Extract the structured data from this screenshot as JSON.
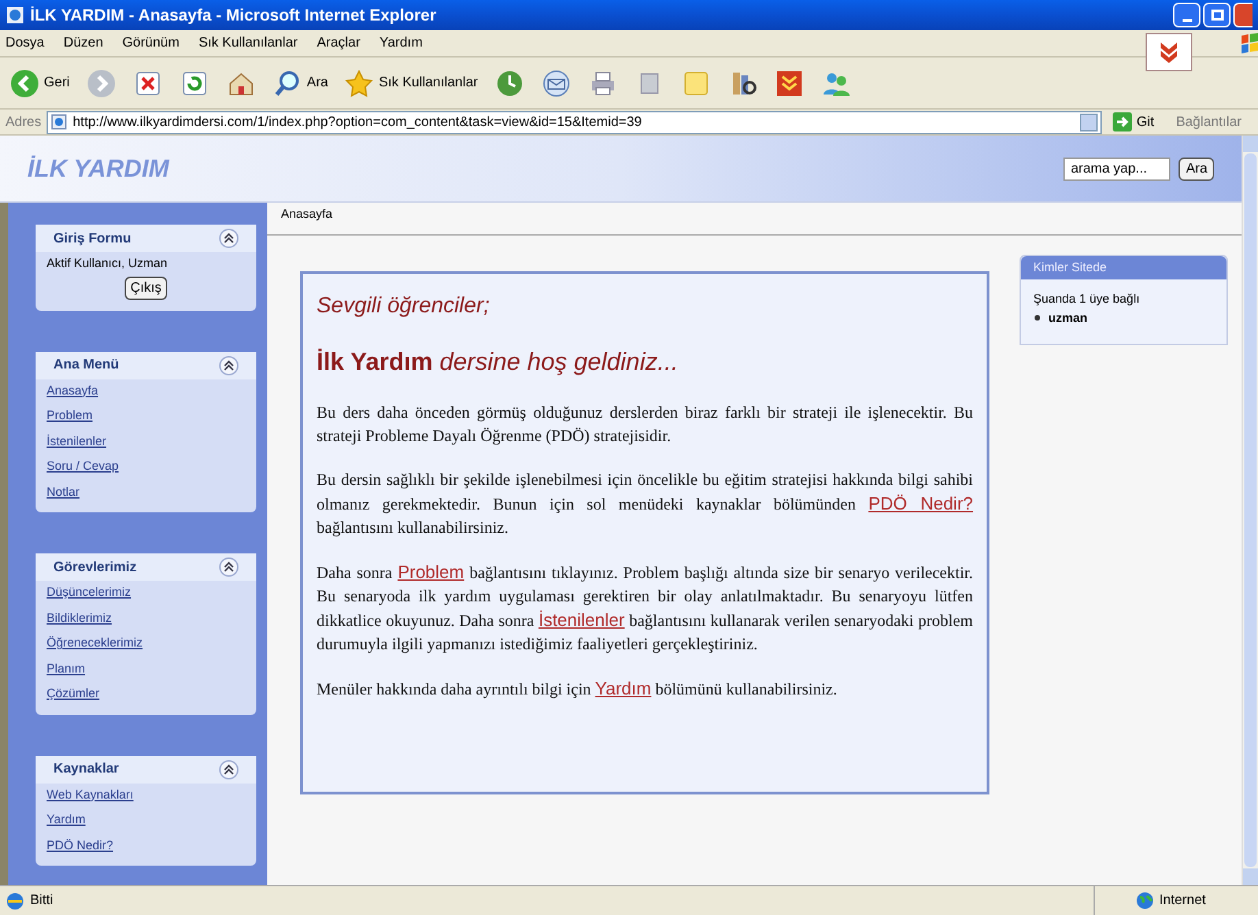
{
  "window": {
    "title": "İLK YARDIM - Anasayfa - Microsoft Internet Explorer"
  },
  "menu": [
    "Dosya",
    "Düzen",
    "Görünüm",
    "Sık Kullanılanlar",
    "Araçlar",
    "Yardım"
  ],
  "toolbar": [
    {
      "kind": "back",
      "label": "Geri"
    },
    {
      "kind": "forward"
    },
    {
      "kind": "stop"
    },
    {
      "kind": "refresh"
    },
    {
      "kind": "home"
    },
    {
      "kind": "search",
      "label": "Ara"
    },
    {
      "kind": "favorites",
      "label": "Sık Kullanılanlar"
    },
    {
      "kind": "history"
    },
    {
      "kind": "mail"
    },
    {
      "kind": "print"
    },
    {
      "kind": "edit"
    },
    {
      "kind": "note"
    },
    {
      "kind": "research"
    },
    {
      "kind": "addon"
    },
    {
      "kind": "messenger"
    }
  ],
  "address": {
    "label": "Adres",
    "url": "http://www.ilkyardimdersi.com/1/index.php?option=com_content&task=view&id=15&Itemid=39",
    "go": "Git",
    "links": "Bağlantılar"
  },
  "site": {
    "logo": "İLK YARDIM",
    "search": {
      "placeholder": "arama yap..."
    },
    "search_button": "Ara"
  },
  "breadcrumb": "Anasayfa",
  "modules": [
    {
      "title": "Giriş Formu",
      "kind": "login",
      "text": "Aktif Kullanıcı, Uzman",
      "button": "Çıkış"
    },
    {
      "title": "Ana Menü",
      "kind": "links",
      "items": [
        "Anasayfa",
        "Problem",
        "İstenilenler",
        "Soru / Cevap",
        "Notlar"
      ]
    },
    {
      "title": "Görevlerimiz",
      "kind": "links",
      "items": [
        "Düşüncelerimiz",
        "Bildiklerimiz",
        "Öğreneceklerimiz",
        "Planım",
        "Çözümler"
      ]
    },
    {
      "title": "Kaynaklar",
      "kind": "links",
      "items": [
        "Web Kaynakları",
        "Yardım",
        "PDÖ Nedir?"
      ]
    }
  ],
  "article": {
    "greeting": "Sevgili öğrenciler;",
    "heading": "**İlk Yardım** dersine hoş geldiniz...",
    "paragraphs": [
      [
        {
          "kind": "text",
          "text": "Bu ders daha önceden görmüş olduğunuz derslerden biraz farklı bir strateji ile işlenecektir. Bu strateji Probleme Dayalı Öğrenme (PDÖ) stratejisidir."
        }
      ],
      [
        {
          "kind": "text",
          "text": "Bu dersin sağlıklı bir şekilde işlenebilmesi için öncelikle bu eğitim stratejisi hakkında bilgi sahibi olmanız gerekmektedir. Bunun için sol menüdeki kaynaklar bölümünden "
        },
        {
          "kind": "link",
          "text": "PDÖ Nedir?"
        },
        {
          "kind": "text",
          "text": " bağlantısını kullanabilirsiniz."
        }
      ],
      [
        {
          "kind": "text",
          "text": "Daha sonra "
        },
        {
          "kind": "link",
          "text": "Problem"
        },
        {
          "kind": "text",
          "text": " bağlantısını tıklayınız. Problem başlığı altında size bir senaryo verilecektir. Bu senaryoda ilk yardım uygulaması gerektiren bir olay anlatılmaktadır. Bu senaryoyu lütfen dikkatlice okuyunuz. Daha sonra "
        },
        {
          "kind": "link",
          "text": "İstenilenler"
        },
        {
          "kind": "text",
          "text": " bağlantısını kullanarak verilen senaryodaki problem durumuyla ilgili yapmanızı istediğimiz faaliyetleri gerçekleştiriniz."
        }
      ],
      [
        {
          "kind": "text",
          "text": "Menüler hakkında daha ayrıntılı bilgi için "
        },
        {
          "kind": "link",
          "text": "Yardım"
        },
        {
          "kind": "text",
          "text": " bölümünü kullanabilirsiniz."
        }
      ]
    ]
  },
  "whos_online": {
    "title": "Kimler Sitede",
    "text": "Şuanda 1 üye bağlı",
    "users": [
      "uzman"
    ]
  },
  "status_bar": {
    "text": "Bitti",
    "zone": "Internet"
  }
}
